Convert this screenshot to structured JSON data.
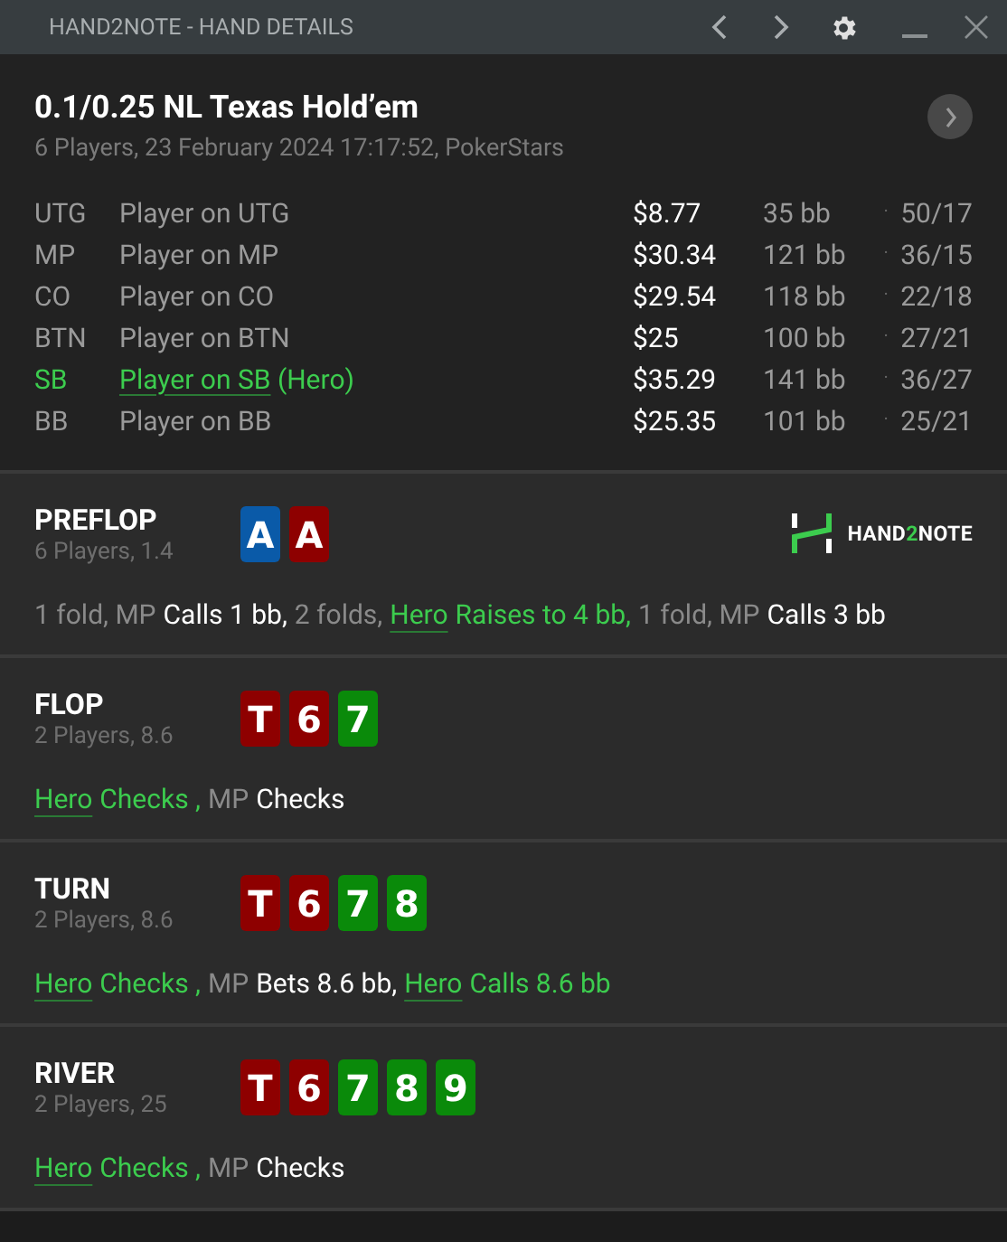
{
  "window": {
    "title": "HAND2NOTE - HAND DETAILS"
  },
  "hand": {
    "title": "0.1/0.25 NL Texas Hold’em",
    "subtitle": "6 Players, 23 February 2024 17:17:52, PokerStars"
  },
  "players": [
    {
      "position": "UTG",
      "name": "Player on UTG",
      "is_hero": false,
      "stack": "$8.77",
      "bb": "35 bb",
      "separator": "·",
      "stats": "50/17"
    },
    {
      "position": "MP",
      "name": "Player on MP",
      "is_hero": false,
      "stack": "$30.34",
      "bb": "121 bb",
      "separator": "·",
      "stats": "36/15"
    },
    {
      "position": "CO",
      "name": "Player on CO",
      "is_hero": false,
      "stack": "$29.54",
      "bb": "118 bb",
      "separator": "·",
      "stats": "22/18"
    },
    {
      "position": "BTN",
      "name": "Player on BTN",
      "is_hero": false,
      "stack": "$25",
      "bb": "100 bb",
      "separator": "·",
      "stats": "27/21"
    },
    {
      "position": "SB",
      "name": "Player on SB",
      "is_hero": true,
      "tag": "(Hero)",
      "stack": "$35.29",
      "bb": "141 bb",
      "separator": "·",
      "stats": "36/27"
    },
    {
      "position": "BB",
      "name": "Player on BB",
      "is_hero": false,
      "stack": "$25.35",
      "bb": "101 bb",
      "separator": "·",
      "stats": "25/21"
    }
  ],
  "logo": {
    "part_1": "HAND",
    "part_2": "2",
    "part_3": "NOTE"
  },
  "streets": [
    {
      "name": "PREFLOP",
      "info": "6 Players, 1.4",
      "cards": [
        {
          "rank": "A",
          "color": "#0a5aa8"
        },
        {
          "rank": "A",
          "color": "#8e0000"
        }
      ],
      "actions": [
        {
          "kind": "info",
          "text": "1 fold, MP"
        },
        {
          "kind": "action",
          "text": "Calls 1 bb,"
        },
        {
          "kind": "info",
          "text": "2 folds,"
        },
        {
          "kind": "hero",
          "text": "Hero"
        },
        {
          "kind": "hero_action",
          "text": "Raises to 4 bb,"
        },
        {
          "kind": "info",
          "text": "1 fold, MP"
        },
        {
          "kind": "action",
          "text": "Calls 3 bb"
        }
      ]
    },
    {
      "name": "FLOP",
      "info": "2 Players, 8.6",
      "cards": [
        {
          "rank": "T",
          "color": "#8e0000"
        },
        {
          "rank": "6",
          "color": "#8e0000"
        },
        {
          "rank": "7",
          "color": "#0a8a0a"
        }
      ],
      "actions": [
        {
          "kind": "hero",
          "text": "Hero"
        },
        {
          "kind": "hero_action",
          "text": "Checks ,"
        },
        {
          "kind": "info",
          "text": "MP"
        },
        {
          "kind": "action",
          "text": "Checks"
        }
      ]
    },
    {
      "name": "TURN",
      "info": "2 Players, 8.6",
      "cards": [
        {
          "rank": "T",
          "color": "#8e0000"
        },
        {
          "rank": "6",
          "color": "#8e0000"
        },
        {
          "rank": "7",
          "color": "#0a8a0a"
        },
        {
          "rank": "8",
          "color": "#0a8a0a"
        }
      ],
      "actions": [
        {
          "kind": "hero",
          "text": "Hero"
        },
        {
          "kind": "hero_action",
          "text": "Checks ,"
        },
        {
          "kind": "info",
          "text": "MP"
        },
        {
          "kind": "action",
          "text": "Bets 8.6 bb,"
        },
        {
          "kind": "hero",
          "text": "Hero"
        },
        {
          "kind": "hero_action",
          "text": "Calls 8.6 bb"
        }
      ]
    },
    {
      "name": "RIVER",
      "info": "2 Players, 25",
      "cards": [
        {
          "rank": "T",
          "color": "#8e0000"
        },
        {
          "rank": "6",
          "color": "#8e0000"
        },
        {
          "rank": "7",
          "color": "#0a8a0a"
        },
        {
          "rank": "8",
          "color": "#0a8a0a"
        },
        {
          "rank": "9",
          "color": "#0a8a0a"
        }
      ],
      "actions": [
        {
          "kind": "hero",
          "text": "Hero"
        },
        {
          "kind": "hero_action",
          "text": "Checks ,"
        },
        {
          "kind": "info",
          "text": "MP"
        },
        {
          "kind": "action",
          "text": "Checks"
        }
      ]
    }
  ]
}
